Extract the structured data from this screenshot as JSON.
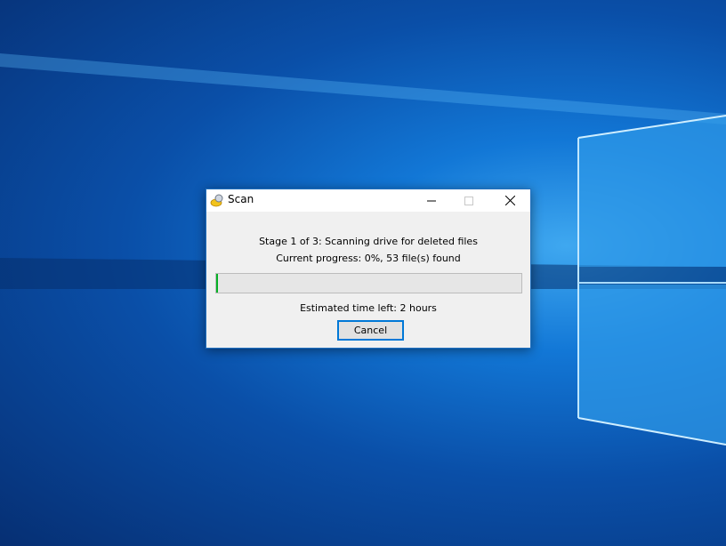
{
  "dialog": {
    "title": "Scan",
    "stage_text": "Stage 1 of 3: Scanning drive for deleted files",
    "progress_text": "Current progress: 0%, 53 file(s) found",
    "progress_percent": 0.6,
    "time_left_text": "Estimated time left: 2 hours",
    "cancel_label": "Cancel"
  },
  "colors": {
    "progress_fill": "#06b025",
    "button_focus": "#0078d7"
  }
}
